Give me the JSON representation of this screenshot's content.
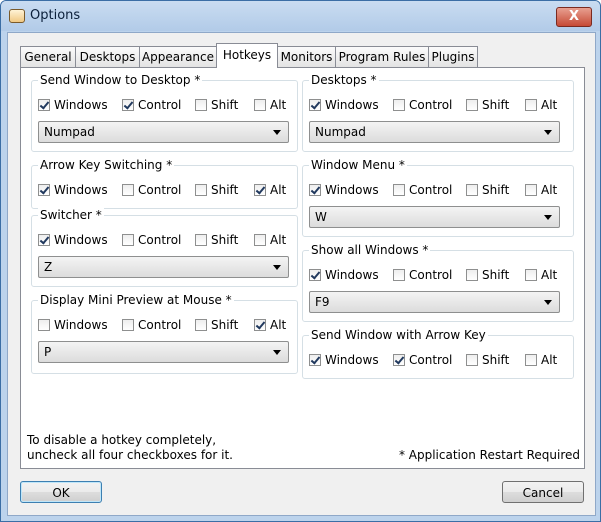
{
  "window": {
    "title": "Options",
    "close_glyph": "X"
  },
  "tabs": [
    "General",
    "Desktops",
    "Appearance",
    "Hotkeys",
    "Monitors",
    "Program Rules",
    "Plugins"
  ],
  "active_tab": "Hotkeys",
  "modifier_labels": {
    "windows": "Windows",
    "control": "Control",
    "shift": "Shift",
    "alt": "Alt"
  },
  "groups": {
    "send_window_to_desktop": {
      "title": "Send Window to Desktop *",
      "windows": true,
      "control": true,
      "shift": false,
      "alt": false,
      "key": "Numpad"
    },
    "arrow_key_switching": {
      "title": "Arrow Key Switching *",
      "windows": true,
      "control": false,
      "shift": false,
      "alt": true
    },
    "switcher": {
      "title": "Switcher *",
      "windows": true,
      "control": false,
      "shift": false,
      "alt": false,
      "key": "Z"
    },
    "display_mini_preview": {
      "title": "Display Mini Preview at Mouse *",
      "windows": false,
      "control": false,
      "shift": false,
      "alt": true,
      "key": "P"
    },
    "desktops": {
      "title": "Desktops *",
      "windows": true,
      "control": false,
      "shift": false,
      "alt": false,
      "key": "Numpad"
    },
    "window_menu": {
      "title": "Window Menu *",
      "windows": true,
      "control": false,
      "shift": false,
      "alt": false,
      "key": "W"
    },
    "show_all_windows": {
      "title": "Show all Windows *",
      "windows": true,
      "control": false,
      "shift": false,
      "alt": false,
      "key": "F9"
    },
    "send_window_with_arrow_key": {
      "title": "Send Window with Arrow Key",
      "windows": true,
      "control": true,
      "shift": false,
      "alt": false
    }
  },
  "notes": {
    "disable_hint": "To disable a hotkey completely,\nuncheck all four checkboxes for it.",
    "restart_required": "* Application Restart Required"
  },
  "buttons": {
    "ok": "OK",
    "cancel": "Cancel"
  }
}
